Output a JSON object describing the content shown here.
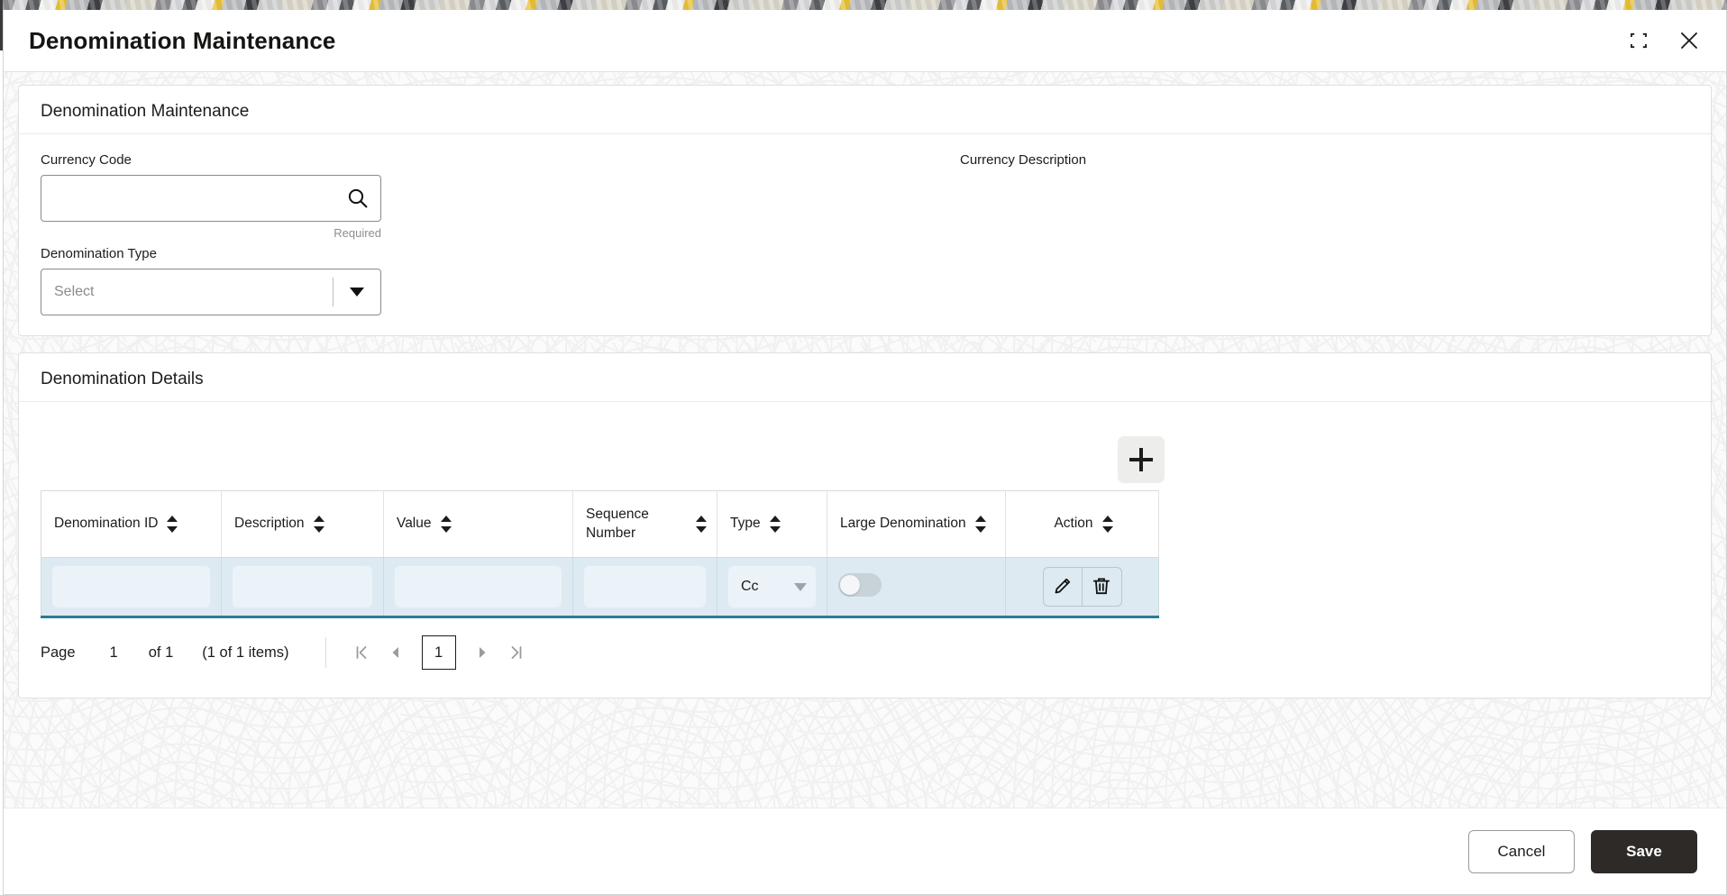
{
  "window": {
    "title": "Denomination Maintenance",
    "minimize_icon": "collapse-icon",
    "close_icon": "close-icon"
  },
  "maintenance_section": {
    "heading": "Denomination Maintenance",
    "currency_code": {
      "label": "Currency Code",
      "value": "",
      "placeholder": "",
      "help_text": "Required",
      "icon": "search-icon"
    },
    "currency_description": {
      "label": "Currency Description",
      "value": ""
    },
    "denomination_type": {
      "label": "Denomination Type",
      "value": "Select",
      "caret_icon": "chevron-down-icon"
    }
  },
  "details_section": {
    "heading": "Denomination Details",
    "add_button": {
      "label": "+",
      "icon": "plus-icon"
    },
    "table": {
      "columns": [
        {
          "label": "Denomination ID",
          "sort_icon": "sort-icon"
        },
        {
          "label": "Description",
          "sort_icon": "sort-icon"
        },
        {
          "label": "Value",
          "sort_icon": "sort-icon"
        },
        {
          "label": "Sequence Number",
          "sort_icon": "sort-icon"
        },
        {
          "label": "Type",
          "sort_icon": "sort-icon"
        },
        {
          "label": "Large Denomination",
          "sort_icon": "sort-icon"
        },
        {
          "label": "Action",
          "sort_icon": "sort-icon"
        }
      ],
      "rows": [
        {
          "denomination_id": "",
          "description": "",
          "value": "",
          "sequence_number": "",
          "type": "Cc",
          "large_denomination": false,
          "actions": {
            "edit_icon": "pencil-icon",
            "delete_icon": "trash-icon"
          }
        }
      ]
    },
    "pagination": {
      "page_label": "Page",
      "current_page": "1",
      "of_label": "of 1",
      "items_label": "(1 of 1 items)",
      "first_icon": "first-page-icon",
      "prev_icon": "prev-page-icon",
      "page_button": "1",
      "next_icon": "next-page-icon",
      "last_icon": "last-page-icon"
    }
  },
  "footer": {
    "cancel_label": "Cancel",
    "save_label": "Save"
  },
  "colors": {
    "save_button": "#2e2a28",
    "row_background": "#ddeaf1",
    "row_accent": "#2b7b99"
  }
}
